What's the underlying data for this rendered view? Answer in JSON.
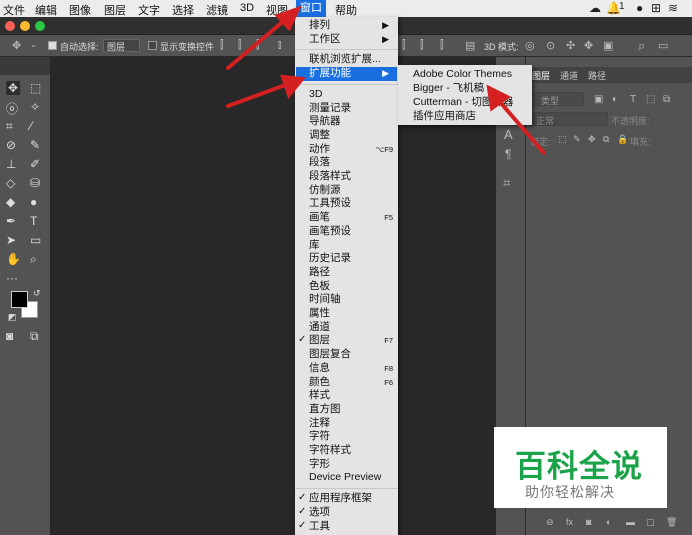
{
  "menubar": {
    "items": [
      "文件",
      "编辑",
      "图像",
      "图层",
      "文字",
      "选择",
      "滤镜",
      "3D",
      "视图",
      "窗口",
      "帮助"
    ],
    "active": "窗口",
    "status": {
      "notif": "1"
    }
  },
  "options": {
    "auto_select_label": "自动选择:",
    "auto_select_value": "图层",
    "show_transform": "显示变换控件",
    "mode_3d": "3D 模式:"
  },
  "window_menu": {
    "top": [
      {
        "label": "排列",
        "submenu": true
      },
      {
        "label": "工作区",
        "submenu": true
      }
    ],
    "ext": [
      {
        "label": "联机浏览扩展..."
      },
      {
        "label": "扩展功能",
        "submenu": true,
        "highlight": true
      }
    ],
    "panels": [
      {
        "label": "3D"
      },
      {
        "label": "测量记录"
      },
      {
        "label": "导航器"
      },
      {
        "label": "调整"
      },
      {
        "label": "动作",
        "shortcut": "⌥F9"
      },
      {
        "label": "段落"
      },
      {
        "label": "段落样式"
      },
      {
        "label": "仿制源"
      },
      {
        "label": "工具预设"
      },
      {
        "label": "画笔",
        "shortcut": "F5"
      },
      {
        "label": "画笔预设"
      },
      {
        "label": "库"
      },
      {
        "label": "历史记录"
      },
      {
        "label": "路径"
      },
      {
        "label": "色板"
      },
      {
        "label": "时间轴"
      },
      {
        "label": "属性"
      },
      {
        "label": "通道"
      },
      {
        "label": "图层",
        "shortcut": "F7",
        "checked": true
      },
      {
        "label": "图层复合"
      },
      {
        "label": "信息",
        "shortcut": "F8"
      },
      {
        "label": "颜色",
        "shortcut": "F6"
      },
      {
        "label": "样式"
      },
      {
        "label": "直方图"
      },
      {
        "label": "注释"
      },
      {
        "label": "字符"
      },
      {
        "label": "字符样式"
      },
      {
        "label": "字形"
      },
      {
        "label": "Device Preview"
      }
    ],
    "bottom": [
      {
        "label": "应用程序框架",
        "checked": true
      },
      {
        "label": "选项",
        "checked": true
      },
      {
        "label": "工具",
        "checked": true
      }
    ]
  },
  "extensions_submenu": {
    "items": [
      "Adobe Color Themes",
      "Bigger - 飞机稿",
      "Cutterman - 切图神器",
      "插件应用商店"
    ]
  },
  "layers_panel": {
    "tabs": [
      "图层",
      "通道",
      "路径"
    ],
    "filter_kind": "类型",
    "blend_mode": "正常",
    "opacity_label": "不透明度:",
    "lock_label": "锁定:",
    "fill_label": "填充:"
  },
  "watermark": {
    "title": "百科全说",
    "subtitle": "助你轻松解决"
  },
  "colors": {
    "accent": "#1a6fe0",
    "arrow": "#d42020",
    "brand": "#1ba34a"
  }
}
